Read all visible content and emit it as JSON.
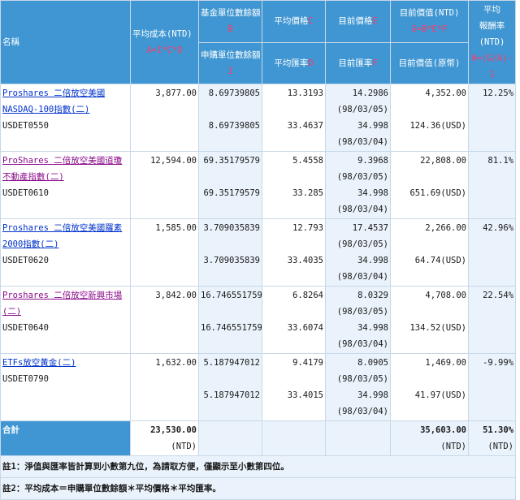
{
  "header": {
    "name": "名稱",
    "avg_cost": "平均成本(NTD)",
    "avg_cost_formula": "A=I*C*D",
    "units_remaining": "基金單位數餘額",
    "units_remaining_key": "B",
    "avg_price": "平均價格",
    "avg_price_key": "C",
    "curr_price": "目前價格",
    "curr_price_key": "E",
    "curr_value": "目前價值(NTD)",
    "curr_value_formula": "G=B*E*F",
    "avg_return_1": "平均",
    "avg_return_2": "報酬率",
    "avg_return_3": "(NTD)",
    "subscribe_units": "申購單位數餘額",
    "subscribe_units_key": "I",
    "avg_fx": "平均匯率",
    "avg_fx_key": "D",
    "curr_fx": "目前匯率",
    "curr_fx_key": "F",
    "curr_value_orig": "目前價值(原幣)",
    "return_formula_1": "H=(G/A)-",
    "return_formula_2": "1"
  },
  "rows": [
    {
      "name": "Proshares 二倍放空美國NASDAQ-100指數(二)",
      "code": "USDET0550",
      "visited": false,
      "avg_cost": "3,877.00",
      "units": "8.69739805",
      "subscribe_units": "8.69739805",
      "avg_price": "13.3193",
      "avg_fx": "33.4637",
      "curr_price": "14.2986",
      "price_date": "(98/03/05)",
      "curr_fx": "34.998",
      "fx_date": "(98/03/04)",
      "curr_value": "4,352.00",
      "curr_value_orig": "124.36(USD)",
      "return": "12.25%"
    },
    {
      "name": "ProShares 二倍放空美國道瓊不動產指數(二)",
      "code": "USDET0610",
      "visited": true,
      "avg_cost": "12,594.00",
      "units": "69.35179579",
      "subscribe_units": "69.35179579",
      "avg_price": "5.4558",
      "avg_fx": "33.285",
      "curr_price": "9.3968",
      "price_date": "(98/03/05)",
      "curr_fx": "34.998",
      "fx_date": "(98/03/04)",
      "curr_value": "22,808.00",
      "curr_value_orig": "651.69(USD)",
      "return": "81.1%"
    },
    {
      "name": "Proshares 二倍放空美國羅素2000指數(二)",
      "code": "USDET0620",
      "visited": false,
      "avg_cost": "1,585.00",
      "units": "3.709035839",
      "subscribe_units": "3.709035839",
      "avg_price": "12.793",
      "avg_fx": "33.4035",
      "curr_price": "17.4537",
      "price_date": "(98/03/05)",
      "curr_fx": "34.998",
      "fx_date": "(98/03/04)",
      "curr_value": "2,266.00",
      "curr_value_orig": "64.74(USD)",
      "return": "42.96%"
    },
    {
      "name": "Proshares 二倍放空新興市場(二)",
      "code": "USDET0640",
      "visited": true,
      "avg_cost": "3,842.00",
      "units": "16.746551759",
      "subscribe_units": "16.746551759",
      "avg_price": "6.8264",
      "avg_fx": "33.6074",
      "curr_price": "8.0329",
      "price_date": "(98/03/05)",
      "curr_fx": "34.998",
      "fx_date": "(98/03/04)",
      "curr_value": "4,708.00",
      "curr_value_orig": "134.52(USD)",
      "return": "22.54%"
    },
    {
      "name": "ETFs放空黃金(二)",
      "code": "USDET0790",
      "visited": false,
      "avg_cost": "1,632.00",
      "units": "5.187947012",
      "subscribe_units": "5.187947012",
      "avg_price": "9.4179",
      "avg_fx": "33.4015",
      "curr_price": "8.0905",
      "price_date": "(98/03/05)",
      "curr_fx": "34.998",
      "fx_date": "(98/03/04)",
      "curr_value": "1,469.00",
      "curr_value_orig": "41.97(USD)",
      "return": "-9.99%"
    }
  ],
  "total": {
    "label": "合計",
    "avg_cost": "23,530.00",
    "avg_cost_unit": "(NTD)",
    "curr_value": "35,603.00",
    "curr_value_unit": "(NTD)",
    "return": "51.30%",
    "return_unit": "(NTD)"
  },
  "notes": {
    "note1": "註1：淨值與匯率皆計算到小數第九位，為請取方便，僅顯示至小數第四位。",
    "note2": "註2：平均成本＝申購單位數餘額＊平均價格＊平均匯率。"
  },
  "colors": {
    "header_bg": "#3f96d2",
    "header_key": "#ff3b6b",
    "row_alt": "#eaf3fb",
    "link": "#0033cc",
    "link_visited": "#8b0a8b"
  }
}
